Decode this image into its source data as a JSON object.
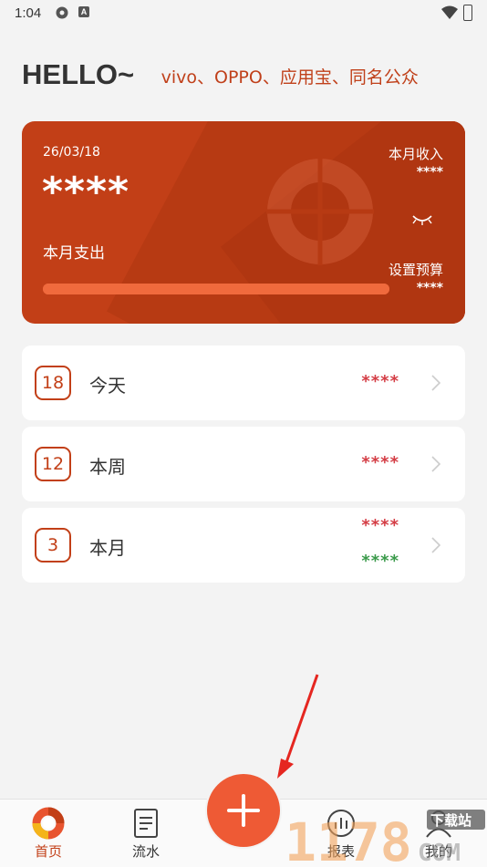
{
  "status_bar": {
    "time": "1:04",
    "icon2_letter": "A"
  },
  "header": {
    "greeting": "HELLO~",
    "marquee": "J、vivo、OPPO、应用宝、同名公众"
  },
  "card": {
    "date": "26/03/18",
    "expense_value": "****",
    "expense_label": "本月支出",
    "income_label": "本月收入",
    "income_value": "****",
    "budget_label": "设置预算",
    "budget_value": "****",
    "progress_percent": 100
  },
  "summary": [
    {
      "badge": "18",
      "label": "今天",
      "expense": "****",
      "income": ""
    },
    {
      "badge": "12",
      "label": "本周",
      "expense": "****",
      "income": ""
    },
    {
      "badge": "3",
      "label": "本月",
      "expense": "****",
      "income": "****"
    }
  ],
  "tabs": [
    {
      "label": "首页",
      "icon": "home-chart-icon",
      "active": true
    },
    {
      "label": "流水",
      "icon": "document-icon",
      "active": false
    },
    {
      "label": "报表",
      "icon": "report-icon",
      "active": false
    },
    {
      "label": "我的",
      "icon": "profile-icon",
      "active": false
    }
  ],
  "fab_icon": "plus-icon",
  "watermark": {
    "text": "1178",
    "subtitle": "下载站",
    "domain": "COM"
  },
  "colors": {
    "brand": "#c23f17",
    "fab": "#ee5a35",
    "expense": "#d43d45",
    "income": "#3a9a4a"
  }
}
